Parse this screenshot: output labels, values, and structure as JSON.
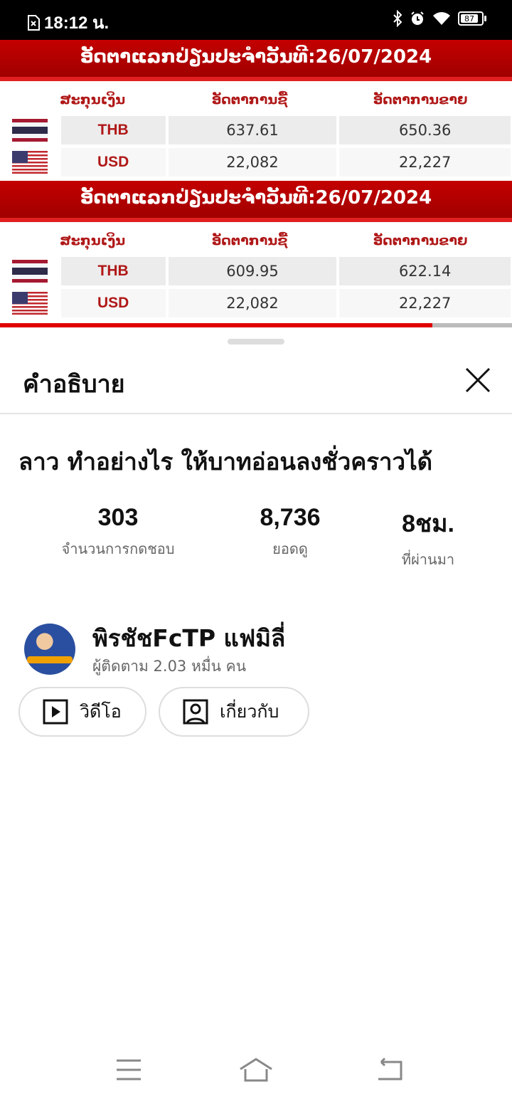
{
  "status_bar": {
    "time": "18:12 น.",
    "battery": "87"
  },
  "video": {
    "rate_blocks": [
      {
        "banner": "ອັດຕາແລກປ່ຽນປະຈຳວັນທີ:26/07/2024",
        "headers": [
          "ສະກຸນເງິນ",
          "ອັດຕາການຊື້",
          "ອັດຕາການຂາຍ"
        ],
        "rows": [
          {
            "currency": "THB",
            "buy": "637.61",
            "sell": "650.36",
            "flag": "thailand-flag"
          },
          {
            "currency": "USD",
            "buy": "22,082",
            "sell": "22,227",
            "flag": "usa-flag"
          }
        ]
      },
      {
        "banner": "ອັດຕາແລກປ່ຽນປະຈຳວັນທີ:26/07/2024",
        "headers": [
          "ສະກຸນເງິນ",
          "ອັດຕາການຊື້",
          "ອັດຕາການຂາຍ"
        ],
        "rows": [
          {
            "currency": "THB",
            "buy": "609.95",
            "sell": "622.14",
            "flag": "thailand-flag"
          },
          {
            "currency": "USD",
            "buy": "22,082",
            "sell": "22,227",
            "flag": "usa-flag"
          }
        ]
      }
    ],
    "progress_fraction": 0.845,
    "progress_color": "#e00000"
  },
  "sheet": {
    "title": "คำอธิบาย",
    "video_title": "ลาว ทำอย่างไร ให้บาทอ่อนลงชั่วคราวได้",
    "stats": [
      {
        "value": "303",
        "label": "จำนวนการกดชอบ"
      },
      {
        "value": "8,736",
        "label": "ยอดดู"
      },
      {
        "value": "8ชม.",
        "label": "ที่ผ่านมา"
      }
    ],
    "channel": {
      "name": "พิรชัชFcTP แฟมิลี่",
      "subscribers": "ผู้ติดตาม 2.03 หมื่น คน"
    },
    "buttons": {
      "videos": "วิดีโอ",
      "about": "เกี่ยวกับ"
    }
  }
}
